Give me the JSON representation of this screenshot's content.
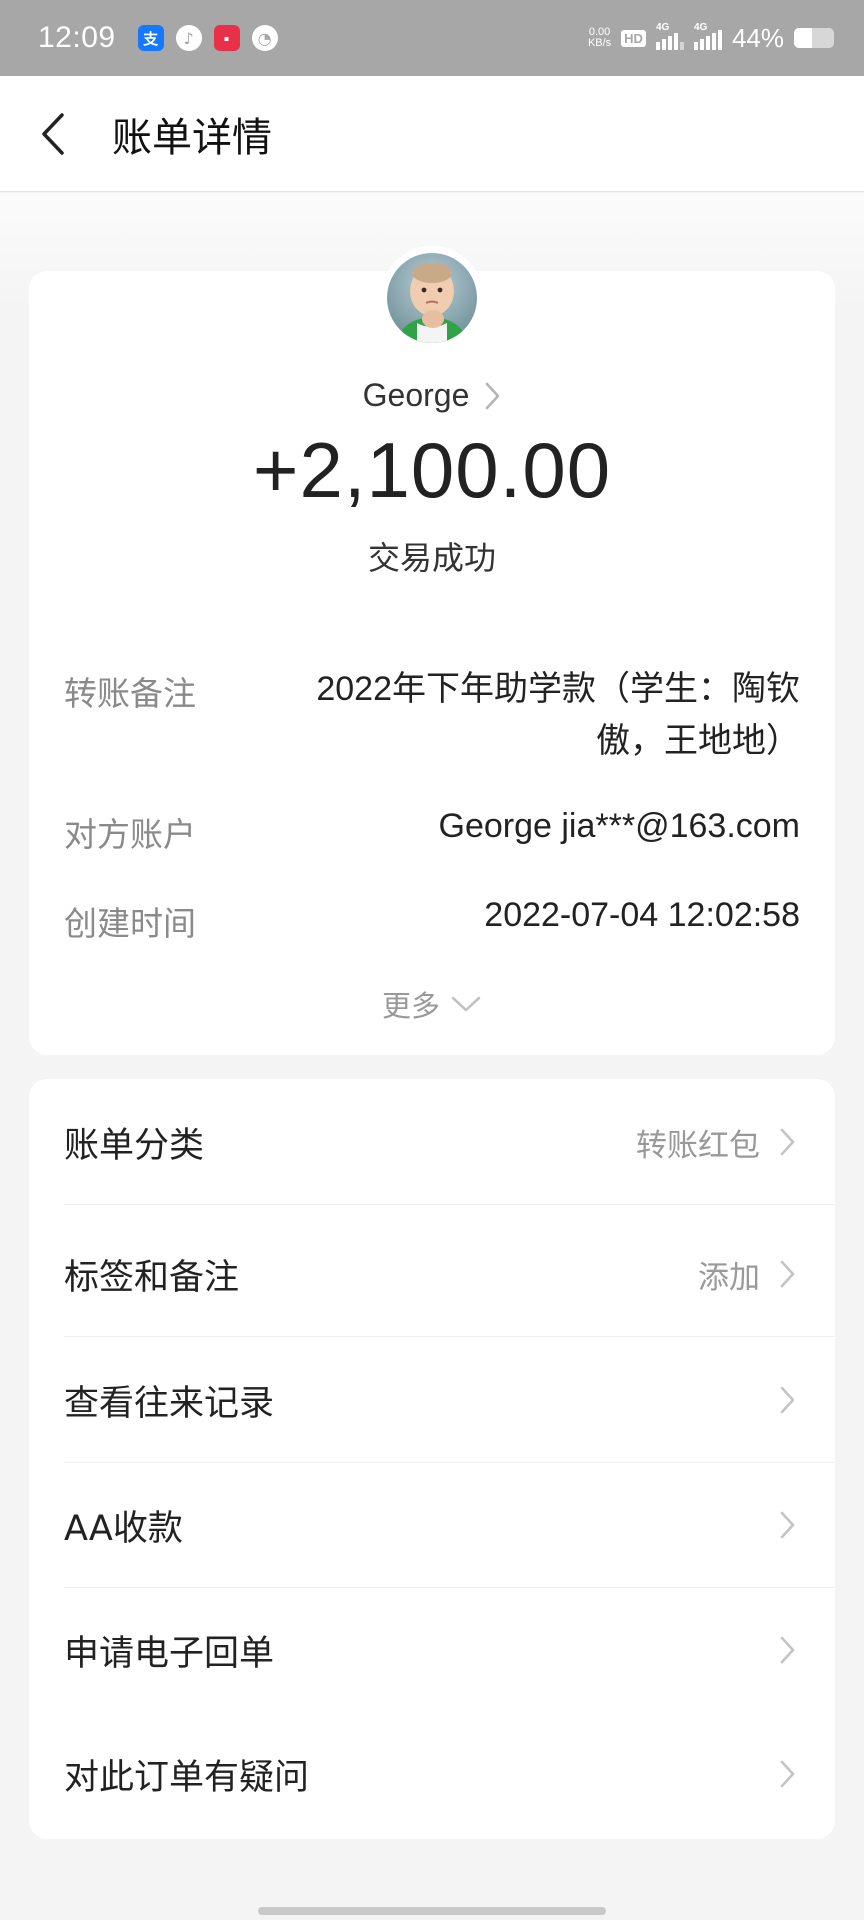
{
  "status_bar": {
    "time": "12:09",
    "net_speed_value": "0.00",
    "net_speed_unit": "KB/s",
    "hd_label": "HD",
    "sim1_label": "4G",
    "sim2_label": "4G",
    "battery_percent": "44%",
    "battery_level": 0.44
  },
  "header": {
    "title": "账单详情"
  },
  "detail": {
    "payer_name": "George",
    "amount": "+2,100.00",
    "status": "交易成功",
    "memo_label": "转账备注",
    "memo_value": "2022年下年助学款（学生：陶钦傲，王地地）",
    "account_label": "对方账户",
    "account_value": "George jia***@163.com",
    "time_label": "创建时间",
    "time_value": "2022-07-04 12:02:58",
    "more_label": "更多"
  },
  "actions": [
    {
      "label": "账单分类",
      "value": "转账红包"
    },
    {
      "label": "标签和备注",
      "value": "添加"
    },
    {
      "label": "查看往来记录",
      "value": ""
    },
    {
      "label": "AA收款",
      "value": ""
    },
    {
      "label": "申请电子回单",
      "value": ""
    },
    {
      "label": "对此订单有疑问",
      "value": ""
    }
  ]
}
